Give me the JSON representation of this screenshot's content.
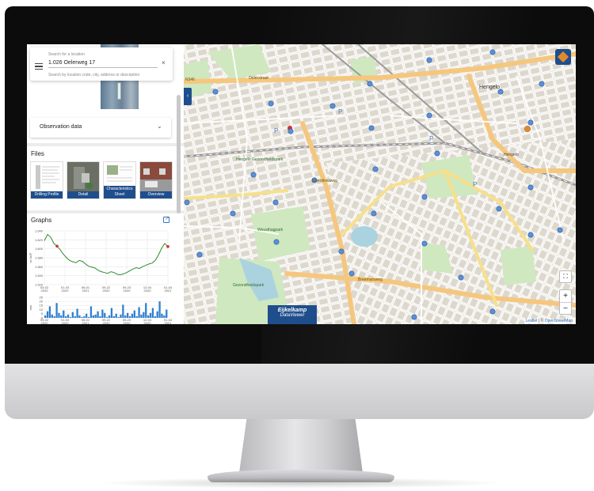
{
  "search": {
    "label": "Search for a location",
    "value": "1.026 Oelerweg 17",
    "hint": "Search by location code, city, address or description",
    "clear_symbol": "×"
  },
  "observation": {
    "label": "Observation data",
    "chevron": "⌄"
  },
  "files": {
    "title": "Files",
    "items": [
      {
        "label": "Drilling Profile"
      },
      {
        "label": "Detail"
      },
      {
        "label": "Characteristics Sheet"
      },
      {
        "label": "Overview"
      }
    ]
  },
  "graphs": {
    "title": "Graphs",
    "export_icon": "external-link-icon"
  },
  "chart_data": [
    {
      "type": "line",
      "title": "",
      "ylabel": "m NAP",
      "ylim": [
        1.52,
        1.64
      ],
      "yticks": [
        "1.640",
        "1.620",
        "1.600",
        "1.580",
        "1.560",
        "1.540",
        "1.520"
      ],
      "xticks": [
        "03-02\n2020",
        "01-03\n2020",
        "06-01\n2021",
        "09-22\n2020",
        "09-23\n2020",
        "12-04\n2020",
        "01-04\n2021"
      ],
      "series": [
        {
          "color": "#2e8b2e",
          "values": [
            1.618,
            1.632,
            1.626,
            1.612,
            1.606,
            1.598,
            1.588,
            1.58,
            1.574,
            1.571,
            1.569,
            1.574,
            1.572,
            1.566,
            1.561,
            1.559,
            1.557,
            1.552,
            1.549,
            1.547,
            1.545,
            1.549,
            1.547,
            1.543,
            1.542,
            1.544,
            1.547,
            1.551,
            1.555,
            1.558,
            1.556,
            1.56,
            1.563,
            1.566,
            1.568,
            1.574,
            1.586,
            1.601,
            1.612,
            1.605
          ]
        }
      ],
      "markers": [
        {
          "index": 4,
          "color": "#d32f2f"
        },
        {
          "index": 39,
          "color": "#d32f2f"
        }
      ]
    },
    {
      "type": "bar",
      "ylabel": "mm",
      "ylim": [
        0,
        25
      ],
      "yticks": [
        "25",
        "20",
        "15",
        "10",
        "5",
        "0"
      ],
      "xticks": [
        "03-02\n2020",
        "01-03\n2020",
        "06-01\n2021",
        "09-22\n2020",
        "09-23\n2020",
        "12-04\n2020",
        "01-04\n2021"
      ],
      "color": "#2f7fd0",
      "values": [
        3,
        8,
        14,
        4,
        2,
        18,
        6,
        3,
        9,
        2,
        4,
        1,
        7,
        2,
        11,
        3,
        1,
        2,
        5,
        1,
        14,
        3,
        4,
        8,
        2,
        10,
        6,
        1,
        3,
        12,
        2,
        5,
        1,
        4,
        16,
        3,
        6,
        2,
        5,
        9,
        2,
        13,
        4,
        7,
        18,
        3,
        6,
        12,
        2,
        8,
        20,
        5,
        3,
        10
      ]
    }
  ],
  "map": {
    "collapse_symbol": "‹",
    "layers_icon": "layers-icon",
    "zoom_in": "+",
    "zoom_out": "−",
    "fullscreen_symbol": "⛶",
    "attribution_prefix": "Leaflet",
    "attribution_sep": " | © ",
    "attribution_osm": "OpenStreetMap",
    "labels": {
      "city_north": "Hengelo",
      "station": "Hengelo",
      "park": "Hengelo Gezondheidspark",
      "road_n346": "N346",
      "street_1": "Oelerstraat",
      "street_2": "Breemarsweg",
      "street_3": "Geerdinksweg",
      "park_2": "Weusthagpark",
      "lake_park": "Gezondheidspark"
    },
    "marker_color": "#5b8fd6",
    "selected_marker_color": "#e08a2e"
  },
  "logo": {
    "line1": "Eijkelkamp",
    "line2": "DataViewer"
  }
}
